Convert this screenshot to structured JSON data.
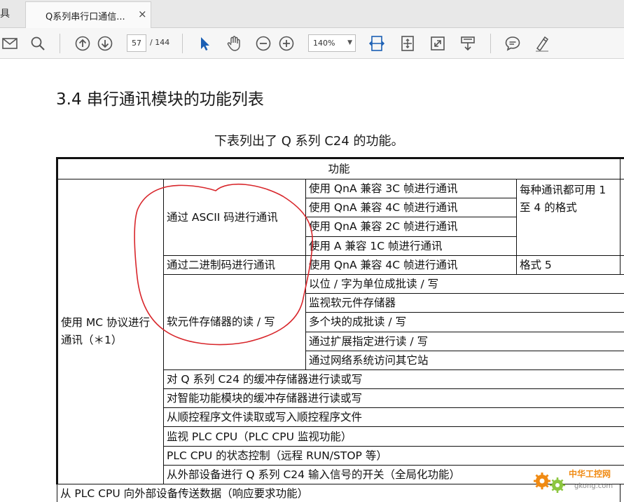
{
  "tabbar": {
    "prev_tab_fragment": "具",
    "tab_title": "Q系列串行口通信...",
    "close_glyph": "×"
  },
  "toolbar": {
    "icons": [
      "mail-icon",
      "search-icon",
      "arrow-up-icon",
      "arrow-down-icon",
      "select-arrow-icon",
      "hand-icon",
      "zoom-out-icon",
      "zoom-in-icon",
      "fit-width-icon",
      "fit-page-icon",
      "fullscreen-icon",
      "read-mode-icon",
      "comment-icon",
      "highlight-icon"
    ],
    "current_page": "57",
    "total_pages": "/ 144",
    "zoom_level": "140%",
    "zoom_caret": "▼"
  },
  "document": {
    "section_heading": "3.4 串行通讯模块的功能列表",
    "intro": "下表列出了 Q 系列 C24 的功能。",
    "table": {
      "header": "功能",
      "mc_group": "使用 MC 协议进行通讯（＊1）",
      "ascii_group": "通过 ASCII 码进行通讯",
      "ascii_rows": [
        "使用 QnA 兼容 3C 帧进行通讯",
        "使用 QnA 兼容 4C 帧进行通讯",
        "使用 QnA 兼容 2C 帧进行通讯",
        "使用 A 兼容 1C 帧进行通讯"
      ],
      "ascii_note": "每种通讯都可用 1 至 4 的格式",
      "binary_group": "通过二进制码进行通讯",
      "binary_row": "使用 QnA 兼容 4C 帧进行通讯",
      "binary_note": "格式 5",
      "device_group": "软元件存储器的读 / 写",
      "device_rows": [
        "以位 / 字为单位成批读 / 写",
        "监视软元件存储器",
        "多个块的成批读 / 写",
        "通过扩展指定进行读 / 写",
        "通过网络系统访问其它站"
      ],
      "other_rows": [
        "对 Q 系列 C24 的缓冲存储器进行读或写",
        "对智能功能模块的缓冲存储器进行读或写",
        "从顺控程序文件读取或写入顺控程序文件",
        "监视 PLC CPU（PLC CPU 监视功能）",
        "PLC CPU 的状态控制（远程 RUN/STOP 等）",
        "从外部设备进行 Q 系列 C24 输入信号的开关（全局化功能）",
        "从 PLC CPU 向外部设备传送数据（响应要求功能）"
      ]
    }
  },
  "colors": {
    "annotation": "#d8262b",
    "logo_orange": "#f08a12",
    "logo_green": "#8cc63f",
    "select_arrow": "#1a5fb4"
  },
  "watermark": {
    "name": "中华工控网",
    "url": "gkong.com"
  }
}
